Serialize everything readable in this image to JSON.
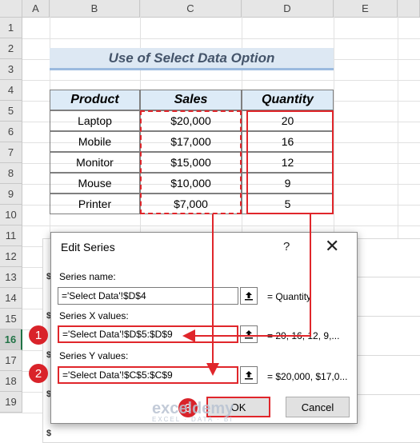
{
  "columns": [
    "A",
    "B",
    "C",
    "D",
    "E"
  ],
  "rows": [
    "1",
    "2",
    "3",
    "4",
    "5",
    "6",
    "7",
    "8",
    "9",
    "10",
    "11",
    "12",
    "13",
    "14",
    "15",
    "16",
    "17",
    "18",
    "19"
  ],
  "selected_row": "16",
  "title": "Use of Select Data Option",
  "table": {
    "headers": [
      "Product",
      "Sales",
      "Quantity"
    ],
    "rows": [
      [
        "Laptop",
        "$20,000",
        "20"
      ],
      [
        "Mobile",
        "$17,000",
        "16"
      ],
      [
        "Monitor",
        "$15,000",
        "12"
      ],
      [
        "Mouse",
        "$10,000",
        "9"
      ],
      [
        "Printer",
        "$7,000",
        "5"
      ]
    ]
  },
  "chart_axis_labels": [
    "$",
    "$",
    "$",
    "$",
    "$"
  ],
  "dialog": {
    "title": "Edit Series",
    "help": "?",
    "close": "✕",
    "series_name_label": "Series name:",
    "series_name_value": "='Select Data'!$D$4",
    "series_name_result": "= Quantity",
    "x_label": "Series X values:",
    "x_value": "='Select Data'!$D$5:$D$9",
    "x_result": "= 20, 16, 12, 9,...",
    "y_label": "Series Y values:",
    "y_value": "='Select Data'!$C$5:$C$9",
    "y_result": "= $20,000, $17,0...",
    "ok": "OK",
    "cancel": "Cancel"
  },
  "badges": [
    "1",
    "2",
    "3"
  ],
  "watermark": {
    "name": "exceldemy",
    "tagline": "EXCEL · DATA · BI"
  },
  "colors": {
    "accent_red": "#e0262b",
    "header_fill": "#ddebf7",
    "excel_green": "#217346"
  }
}
